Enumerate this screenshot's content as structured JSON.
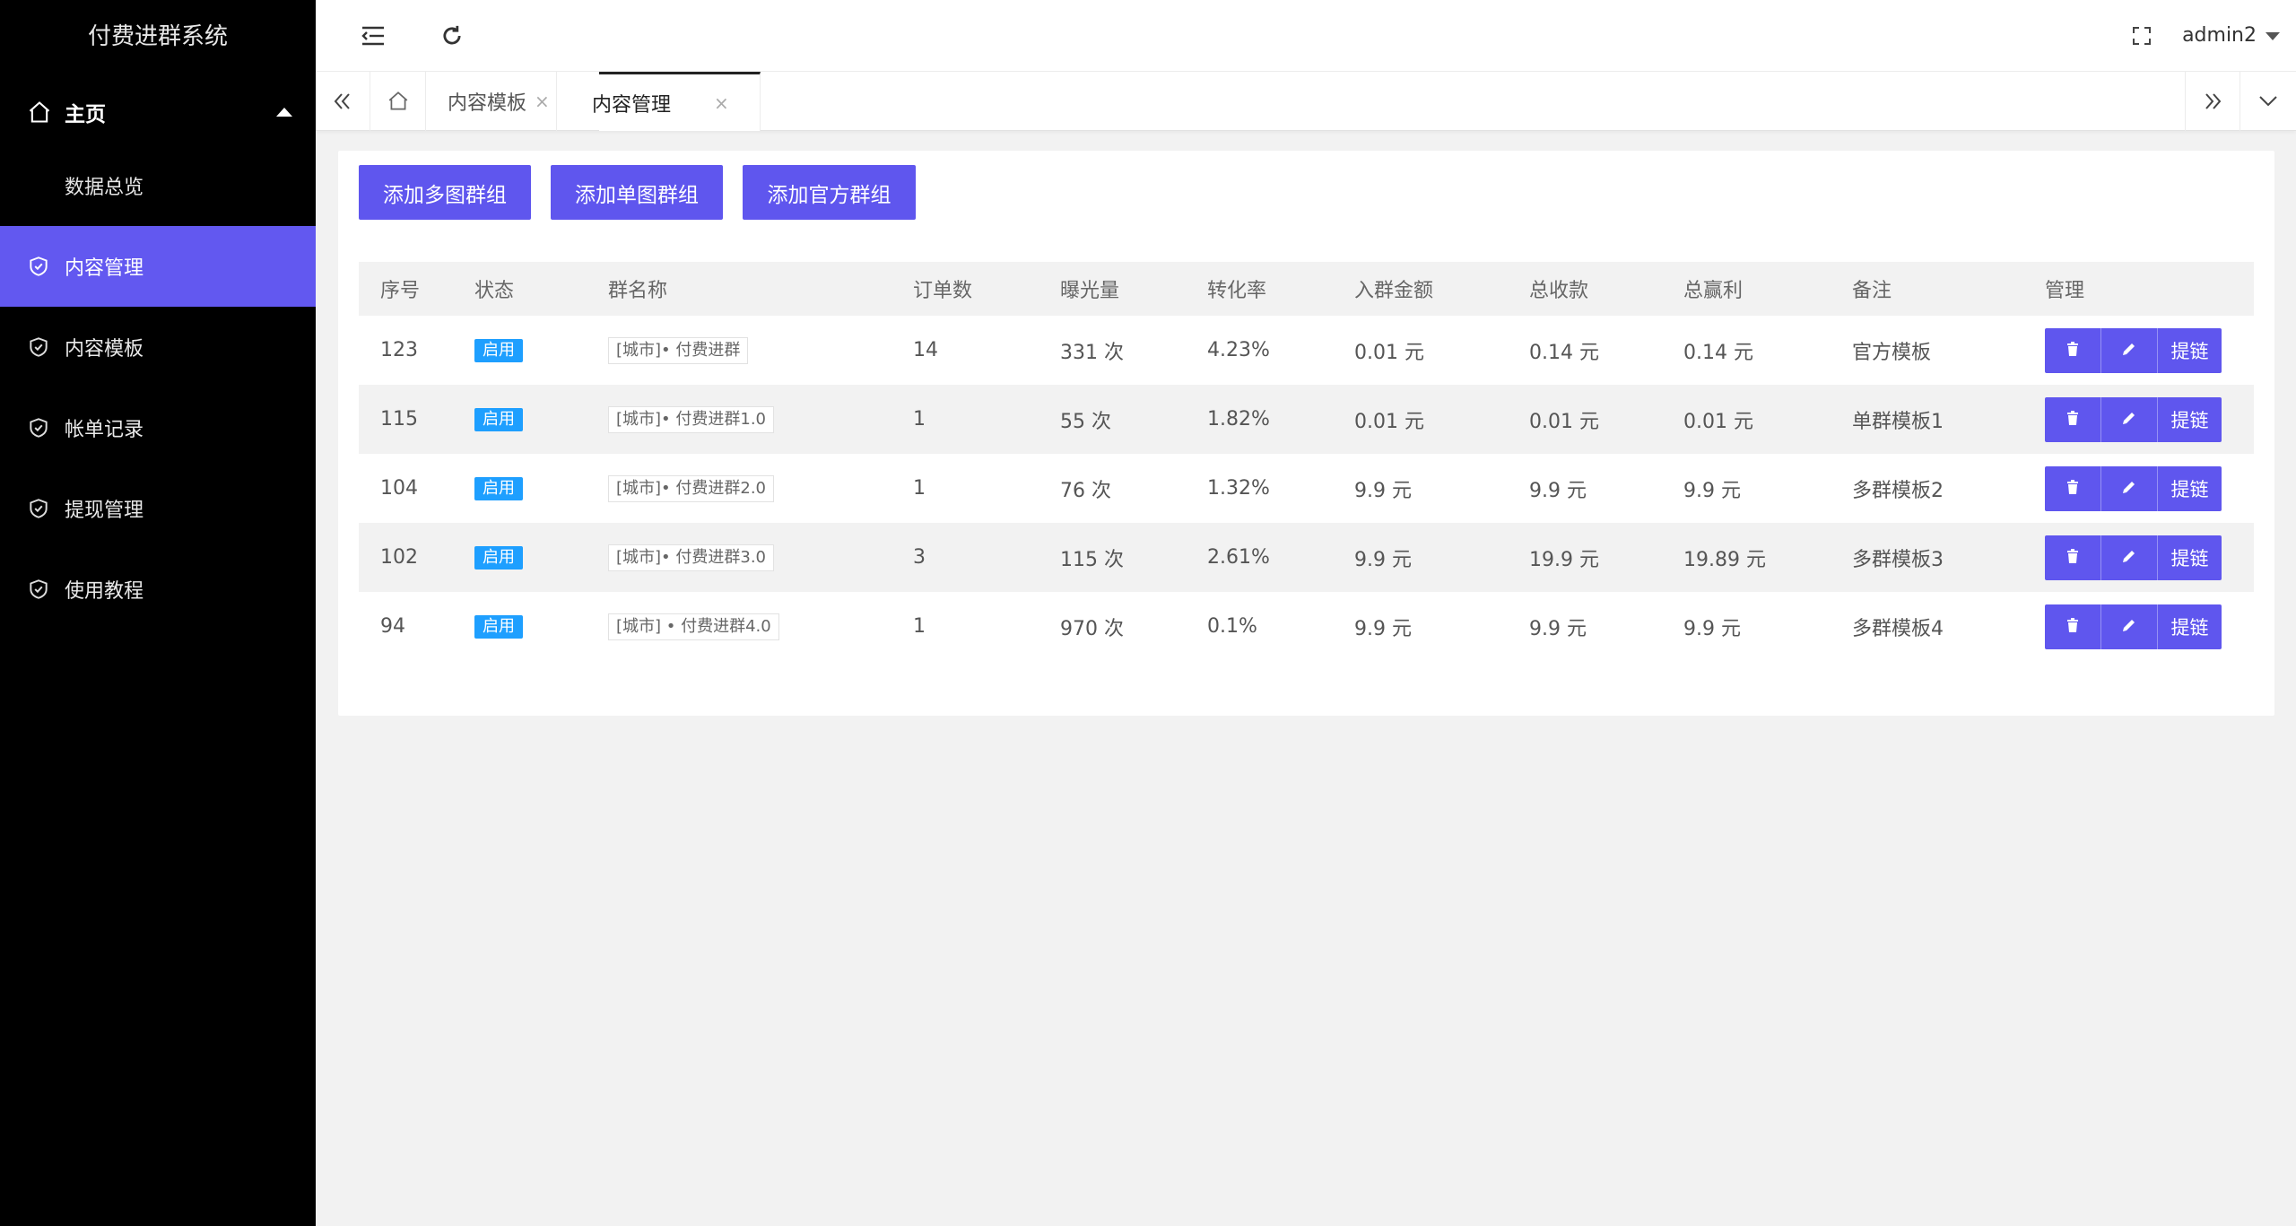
{
  "app": {
    "title": "付费进群系统",
    "user": "admin2"
  },
  "colors": {
    "accent": "#5f56ee",
    "badge": "#1e9fff",
    "sidebar": "#000000"
  },
  "sidebar": {
    "group": {
      "label": "主页",
      "icon": "home-icon"
    },
    "sub_items": [
      {
        "label": "数据总览"
      }
    ],
    "items": [
      {
        "label": "内容管理",
        "icon": "shield-check-icon",
        "active": true
      },
      {
        "label": "内容模板",
        "icon": "shield-check-icon"
      },
      {
        "label": "帐单记录",
        "icon": "shield-check-icon"
      },
      {
        "label": "提现管理",
        "icon": "shield-check-icon"
      },
      {
        "label": "使用教程",
        "icon": "shield-check-icon"
      }
    ]
  },
  "tabs": [
    {
      "label": "内容模板",
      "close": "×"
    },
    {
      "label": "内容管理",
      "close": "×",
      "active": true
    }
  ],
  "toolbar": {
    "add_multi": "添加多图群组",
    "add_single": "添加单图群组",
    "add_official": "添加官方群组"
  },
  "table": {
    "headers": [
      "序号",
      "状态",
      "群名称",
      "订单数",
      "曝光量",
      "转化率",
      "入群金额",
      "总收款",
      "总赢利",
      "备注",
      "管理"
    ],
    "rows": [
      {
        "id": "123",
        "status": "启用",
        "name": "[城市]• 付费进群",
        "orders": "14",
        "views": "331 次",
        "rate": "4.23%",
        "fee": "0.01 元",
        "income": "0.14 元",
        "profit": "0.14 元",
        "note": "官方模板",
        "link": "提链"
      },
      {
        "id": "115",
        "status": "启用",
        "name": "[城市]• 付费进群1.0",
        "orders": "1",
        "views": "55 次",
        "rate": "1.82%",
        "fee": "0.01 元",
        "income": "0.01 元",
        "profit": "0.01 元",
        "note": "单群模板1",
        "link": "提链"
      },
      {
        "id": "104",
        "status": "启用",
        "name": "[城市]• 付费进群2.0",
        "orders": "1",
        "views": "76 次",
        "rate": "1.32%",
        "fee": "9.9 元",
        "income": "9.9 元",
        "profit": "9.9 元",
        "note": "多群模板2",
        "link": "提链"
      },
      {
        "id": "102",
        "status": "启用",
        "name": "[城市]• 付费进群3.0",
        "orders": "3",
        "views": "115 次",
        "rate": "2.61%",
        "fee": "9.9 元",
        "income": "19.9 元",
        "profit": "19.89 元",
        "note": "多群模板3",
        "link": "提链"
      },
      {
        "id": "94",
        "status": "启用",
        "name": "[城市] • 付费进群4.0",
        "orders": "1",
        "views": "970 次",
        "rate": "0.1%",
        "fee": "9.9 元",
        "income": "9.9 元",
        "profit": "9.9 元",
        "note": "多群模板4",
        "link": "提链"
      }
    ]
  }
}
